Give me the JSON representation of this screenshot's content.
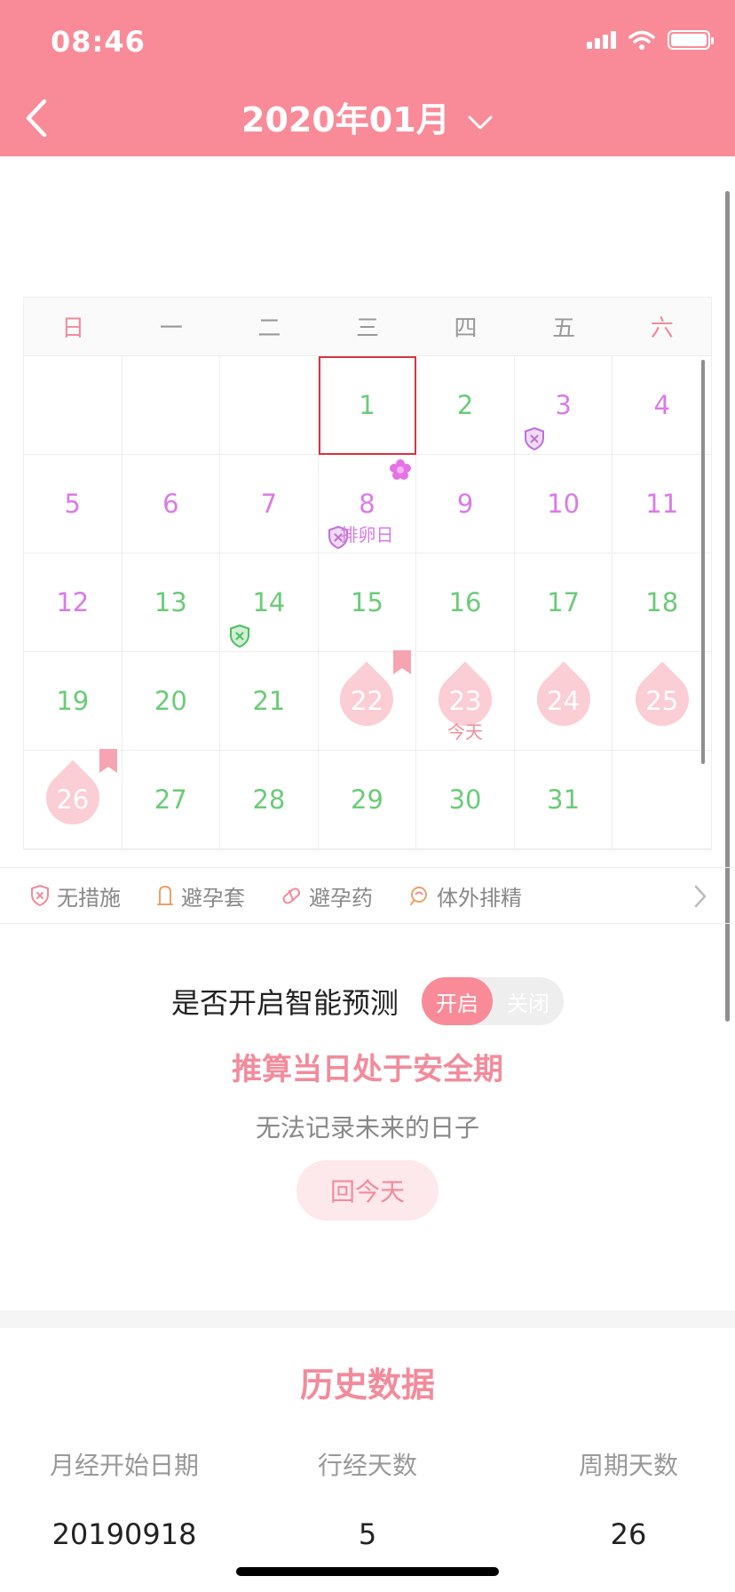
{
  "status_bar": {
    "time": "08:46"
  },
  "header": {
    "title": "2020年01月"
  },
  "colors": {
    "accent": "#F98B98",
    "pink_text": "#F28B9B",
    "green_day": "#6BCB77",
    "purple_day": "#D97BE6",
    "drop": "#FBCDD4"
  },
  "weekdays": [
    "日",
    "一",
    "二",
    "三",
    "四",
    "五",
    "六"
  ],
  "days": [
    {
      "n": ""
    },
    {
      "n": ""
    },
    {
      "n": ""
    },
    {
      "n": "1",
      "c": "green",
      "selected": true
    },
    {
      "n": "2",
      "c": "green"
    },
    {
      "n": "3",
      "c": "purple",
      "icon": "shield-purple"
    },
    {
      "n": "4",
      "c": "purple"
    },
    {
      "n": "5",
      "c": "purple"
    },
    {
      "n": "6",
      "c": "purple"
    },
    {
      "n": "7",
      "c": "purple"
    },
    {
      "n": "8",
      "c": "purple",
      "icon": "shield-purple",
      "flower": true,
      "sub": "排卵日"
    },
    {
      "n": "9",
      "c": "purple"
    },
    {
      "n": "10",
      "c": "purple"
    },
    {
      "n": "11",
      "c": "purple"
    },
    {
      "n": "12",
      "c": "purple"
    },
    {
      "n": "13",
      "c": "green"
    },
    {
      "n": "14",
      "c": "green",
      "icon": "shield-green"
    },
    {
      "n": "15",
      "c": "green"
    },
    {
      "n": "16",
      "c": "green"
    },
    {
      "n": "17",
      "c": "green"
    },
    {
      "n": "18",
      "c": "green"
    },
    {
      "n": "19",
      "c": "green"
    },
    {
      "n": "20",
      "c": "green"
    },
    {
      "n": "21",
      "c": "green"
    },
    {
      "n": "22",
      "c": "white",
      "drop": true,
      "flag": true
    },
    {
      "n": "23",
      "c": "white",
      "drop": true,
      "sub": "今天",
      "subpink": true
    },
    {
      "n": "24",
      "c": "white",
      "drop": true
    },
    {
      "n": "25",
      "c": "white",
      "drop": true
    },
    {
      "n": "26",
      "c": "white",
      "drop": true,
      "flag": true
    },
    {
      "n": "27",
      "c": "green"
    },
    {
      "n": "28",
      "c": "green"
    },
    {
      "n": "29",
      "c": "green"
    },
    {
      "n": "30",
      "c": "green"
    },
    {
      "n": "31",
      "c": "green"
    },
    {
      "n": ""
    }
  ],
  "legend": {
    "none": "无措施",
    "condom": "避孕套",
    "pill": "避孕药",
    "withdrawal": "体外排精"
  },
  "prediction": {
    "label": "是否开启智能预测",
    "on": "开启",
    "off": "关闭",
    "status": "推算当日处于安全期",
    "note": "无法记录未来的日子",
    "today_button": "回今天"
  },
  "history": {
    "title": "历史数据",
    "headers": [
      "月经开始日期",
      "行经天数",
      "周期天数"
    ],
    "values": [
      "20190918",
      "5",
      "26"
    ]
  }
}
